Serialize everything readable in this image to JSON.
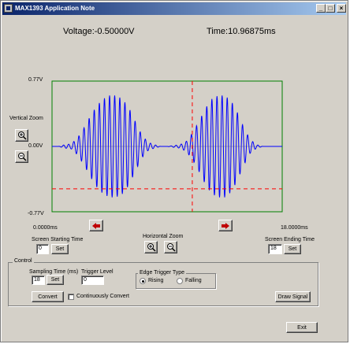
{
  "window": {
    "title": "MAX1393 Application Note",
    "minimize": "_",
    "maximize": "□",
    "close": "×"
  },
  "readouts": {
    "voltage": "Voltage:-0.50000V",
    "time": "Time:10.96875ms"
  },
  "plot": {
    "y_max_label": "0.77V",
    "y_mid_label": "0.00V",
    "y_min_label": "-0.77V",
    "x_start_label": "0.0000ms",
    "x_end_label": "18.0000ms",
    "colors": {
      "frame": "#008000",
      "trace": "#0000ff",
      "cursor": "#ff0000",
      "zero": "#808080"
    }
  },
  "chart_data": {
    "type": "line",
    "xlabel": "",
    "ylabel": "",
    "xlim": [
      0,
      18
    ],
    "ylim": [
      -0.77,
      0.77
    ],
    "x_unit": "ms",
    "y_unit": "V",
    "series": [
      {
        "x": [
          0.0,
          0.5,
          1.0,
          1.5,
          2.0,
          2.5,
          3.0,
          3.5,
          4.0,
          4.5,
          5.0,
          5.5,
          6.0,
          6.5,
          7.0,
          7.5,
          8.0,
          8.5,
          9.0,
          9.5,
          10.0,
          10.5,
          11.0,
          11.5,
          12.0,
          12.5,
          13.0,
          13.5,
          14.0,
          14.5,
          15.0,
          15.5,
          16.0,
          16.5,
          17.0,
          17.5,
          18.0
        ],
        "envelope": [
          0.0,
          0.0,
          0.02,
          0.03,
          0.1,
          0.22,
          0.36,
          0.48,
          0.56,
          0.6,
          0.6,
          0.56,
          0.46,
          0.3,
          0.14,
          0.05,
          0.02,
          0.0,
          0.0,
          0.01,
          0.02,
          0.06,
          0.16,
          0.3,
          0.45,
          0.56,
          0.6,
          0.6,
          0.54,
          0.4,
          0.22,
          0.08,
          0.02,
          0.0,
          0.0,
          0.0,
          0.0
        ],
        "carrier_cycles_per_ms": 2.5
      }
    ],
    "cursor": {
      "time_ms": 10.96875,
      "voltage_v": -0.5
    }
  },
  "vertical_zoom": {
    "label": "Vertical Zoom",
    "zoom_in_icon": "zoom-in-icon",
    "zoom_out_icon": "zoom-out-icon"
  },
  "horizontal_zoom": {
    "label": "Horizontal Zoom",
    "zoom_in_icon": "zoom-in-icon",
    "zoom_out_icon": "zoom-out-icon"
  },
  "scroll": {
    "left_icon": "arrow-left-icon",
    "right_icon": "arrow-right-icon"
  },
  "screen_start": {
    "label": "Screen Starting Time",
    "value": "0",
    "set_label": "Set"
  },
  "screen_end": {
    "label": "Screen Ending Time",
    "value": "18",
    "set_label": "Set"
  },
  "control": {
    "title": "Control",
    "sampling_label": "Sampling Time (ms)",
    "sampling_value": "18",
    "sampling_set": "Set",
    "trigger_label": "Trigger Level",
    "trigger_value": "0",
    "edge_title": "Edge Trigger Type",
    "rising_label": "Rising",
    "falling_label": "Falling",
    "rising_selected": true,
    "convert_label": "Convert",
    "continuous_label": "Continuously Convert",
    "continuous_checked": false,
    "draw_label": "Draw Signal"
  },
  "exit_label": "Exit"
}
